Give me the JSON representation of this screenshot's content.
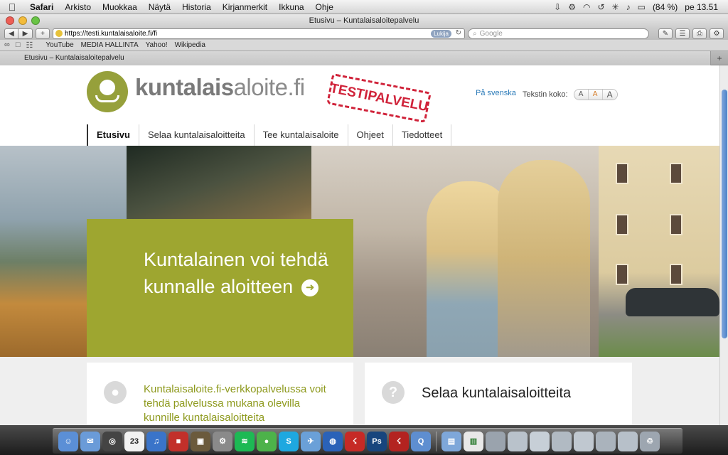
{
  "menubar": {
    "app": "Safari",
    "items": [
      "Arkisto",
      "Muokkaa",
      "Näytä",
      "Historia",
      "Kirjanmerkit",
      "Ikkuna",
      "Ohje"
    ],
    "battery": "(84 %)",
    "clock": "pe 13.51"
  },
  "window": {
    "title": "Etusivu – Kuntalaisaloitepalvelu"
  },
  "toolbar": {
    "url": "https://testi.kuntalaisaloite.fi/fi",
    "reader_label": "Lukija",
    "search_placeholder": "Google"
  },
  "bookmarks": [
    "YouTube",
    "MEDIA HALLINTA",
    "Yahoo!",
    "Wikipedia"
  ],
  "tab": {
    "label": "Etusivu – Kuntalaisaloitepalvelu"
  },
  "site": {
    "logo_bold": "kuntalais",
    "logo_rest": "aloite.fi",
    "stamp": "TESTIPALVELU",
    "lang_link": "På svenska",
    "textsize_label": "Tekstin koko:",
    "textsize_buttons": [
      "A",
      "A",
      "A"
    ],
    "nav": [
      "Etusivu",
      "Selaa kuntalaisaloitteita",
      "Tee kuntalaisaloite",
      "Ohjeet",
      "Tiedotteet"
    ],
    "hero_text": "Kuntalainen voi tehdä kunnalle aloitteen",
    "card_left_text": "Kuntalaisaloite.fi-verkkopalvelussa voit tehdä palvelussa mukana olevilla kunnille kuntalaisaloitteita",
    "card_right_title": "Selaa kuntalaisaloitteita",
    "card_right_icon": "?"
  },
  "dock": {
    "calendar_day": "23"
  },
  "colors": {
    "brand_green": "#9ea630",
    "stamp_red": "#d0233a",
    "link_blue": "#2a7ab8"
  }
}
